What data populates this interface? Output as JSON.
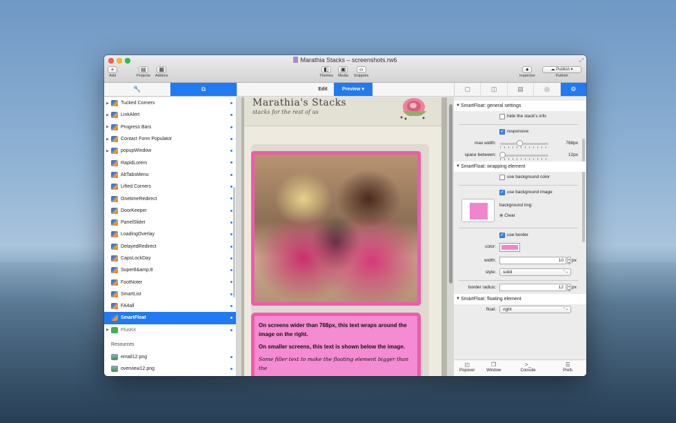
{
  "window": {
    "title": "Marathia Stacks – screenshots.rw6"
  },
  "toolbar": {
    "add_label": "Add",
    "projects_label": "Projects",
    "addons_label": "Addons",
    "themes_label": "Themes",
    "media_label": "Media",
    "snippets_label": "Snippets",
    "inspector_label": "Inspector",
    "publish_label": "Publish",
    "publish_button": "Publish"
  },
  "tabs": {
    "edit": "Edit",
    "preview": "Preview"
  },
  "sidebar": {
    "items": [
      {
        "label": "Tucked Corners",
        "disclosure": "▶"
      },
      {
        "label": "LinkAlert",
        "disclosure": "▶"
      },
      {
        "label": "Progress Bars",
        "disclosure": "▶"
      },
      {
        "label": "Contact Form Populator",
        "disclosure": "▶"
      },
      {
        "label": "popupWindow",
        "disclosure": "▶"
      },
      {
        "label": "RapidLorem",
        "disclosure": ""
      },
      {
        "label": "AltTabsMenu",
        "disclosure": ""
      },
      {
        "label": "Lifted Corners",
        "disclosure": ""
      },
      {
        "label": "OnetimeRedirect",
        "disclosure": ""
      },
      {
        "label": "DoorKeeper",
        "disclosure": ""
      },
      {
        "label": "PanelSlider",
        "disclosure": ""
      },
      {
        "label": "LoadingOverlay",
        "disclosure": ""
      },
      {
        "label": "DelayedRedirect",
        "disclosure": ""
      },
      {
        "label": "CapsLockDay",
        "disclosure": ""
      },
      {
        "label": "Super8&amp;8",
        "disclosure": ""
      },
      {
        "label": "FootNoter",
        "disclosure": ""
      },
      {
        "label": "SmartList",
        "disclosure": ""
      },
      {
        "label": "FA4all",
        "disclosure": ""
      },
      {
        "label": "SmartFloat",
        "disclosure": ""
      },
      {
        "label": "PlusKit",
        "disclosure": "▶"
      }
    ],
    "resources_header": "Resources",
    "resources": [
      {
        "label": "email12.png"
      },
      {
        "label": "overview12.png"
      }
    ]
  },
  "preview": {
    "site_title": "Marathia's Stacks",
    "site_subtitle": "stacks for the rest of us",
    "para1": "On screens wider than 768px, this text wraps around the image on the right.",
    "para2": "On smaller screens, this text is shown below the image.",
    "para3": "Some filler text to make the floating element bigger than the"
  },
  "inspector": {
    "general_header": "SmartFloat: general settings",
    "hide_info_label": "hide the stack's info",
    "responsive_label": "responsive",
    "max_width_label": "max width:",
    "max_width_value": "768px",
    "max_width_fraction": 0.4,
    "space_between_label": "space between:",
    "space_between_value": "12px",
    "space_between_fraction": 0.05,
    "wrapping_header": "SmartFloat: wrapping element",
    "use_bg_color_label": "use background color",
    "use_bg_image_label": "use background image",
    "bg_img_label": "background img:",
    "clear_label": "Clear",
    "use_border_label": "use border",
    "color_label": "color:",
    "border_color": "#f185cd",
    "width_label": "width:",
    "width_value": "10",
    "px_unit": "px",
    "style_label": "style:",
    "style_value": "solid",
    "border_radius_label": "border radius:",
    "border_radius_value": "12",
    "floating_header": "SmartFloat: floating element",
    "float_label": "float:",
    "float_value": "right"
  },
  "bottombar": {
    "popover": "Popover",
    "window": "Window",
    "console": "Console",
    "prefs": "Prefs"
  },
  "colors": {
    "accent": "#1f7af3",
    "pink": "#ef5aae"
  }
}
